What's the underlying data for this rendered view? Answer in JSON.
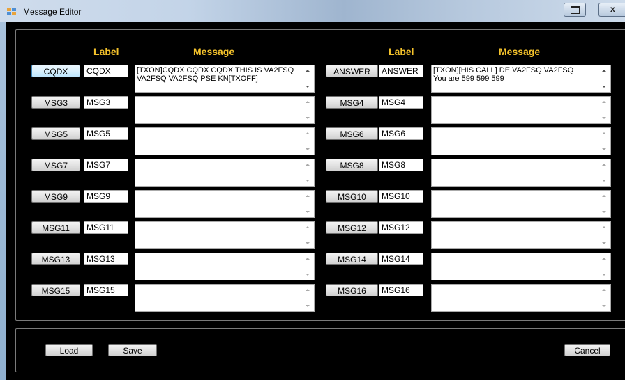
{
  "window": {
    "title": "Message Editor",
    "restore_icon": "restore-icon",
    "close_glyph": "x"
  },
  "headers": {
    "label": "Label",
    "message": "Message"
  },
  "colors": {
    "header_text": "#F4C22B",
    "panel_background": "#000000"
  },
  "left_rows": [
    {
      "button": "CQDX",
      "label": "CQDX",
      "message": "[TXON]CQDX CQDX CQDX THIS IS VA2FSQ\nVA2FSQ VA2FSQ PSE KN[TXOFF]",
      "focused": true
    },
    {
      "button": "MSG3",
      "label": "MSG3",
      "message": ""
    },
    {
      "button": "MSG5",
      "label": "MSG5",
      "message": ""
    },
    {
      "button": "MSG7",
      "label": "MSG7",
      "message": ""
    },
    {
      "button": "MSG9",
      "label": "MSG9",
      "message": ""
    },
    {
      "button": "MSG11",
      "label": "MSG11",
      "message": ""
    },
    {
      "button": "MSG13",
      "label": "MSG13",
      "message": ""
    },
    {
      "button": "MSG15",
      "label": "MSG15",
      "message": ""
    }
  ],
  "right_rows": [
    {
      "button": "ANSWER",
      "label": "ANSWER",
      "message": "[TXON][HIS CALL] DE VA2FSQ VA2FSQ\nYou are 599 599 599"
    },
    {
      "button": "MSG4",
      "label": "MSG4",
      "message": ""
    },
    {
      "button": "MSG6",
      "label": "MSG6",
      "message": ""
    },
    {
      "button": "MSG8",
      "label": "MSG8",
      "message": ""
    },
    {
      "button": "MSG10",
      "label": "MSG10",
      "message": ""
    },
    {
      "button": "MSG12",
      "label": "MSG12",
      "message": ""
    },
    {
      "button": "MSG14",
      "label": "MSG14",
      "message": ""
    },
    {
      "button": "MSG16",
      "label": "MSG16",
      "message": ""
    }
  ],
  "footer": {
    "load": "Load",
    "save": "Save",
    "cancel": "Cancel"
  }
}
